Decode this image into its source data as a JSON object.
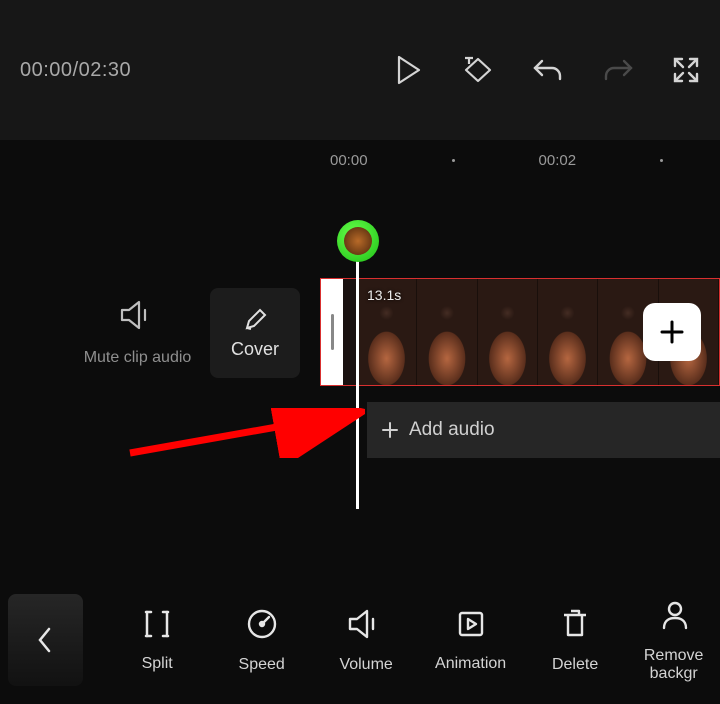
{
  "topbar": {
    "current_time": "00:00",
    "total_time": "02:30"
  },
  "ruler": {
    "marks": [
      "00:00",
      "00:02"
    ]
  },
  "track": {
    "mute_label": "Mute clip audio",
    "cover_label": "Cover",
    "clip_duration": "13.1s",
    "add_audio_label": "Add audio"
  },
  "toolbar": {
    "split": "Split",
    "speed": "Speed",
    "volume": "Volume",
    "animation": "Animation",
    "delete": "Delete",
    "remove_bg": "Remove backgr"
  }
}
